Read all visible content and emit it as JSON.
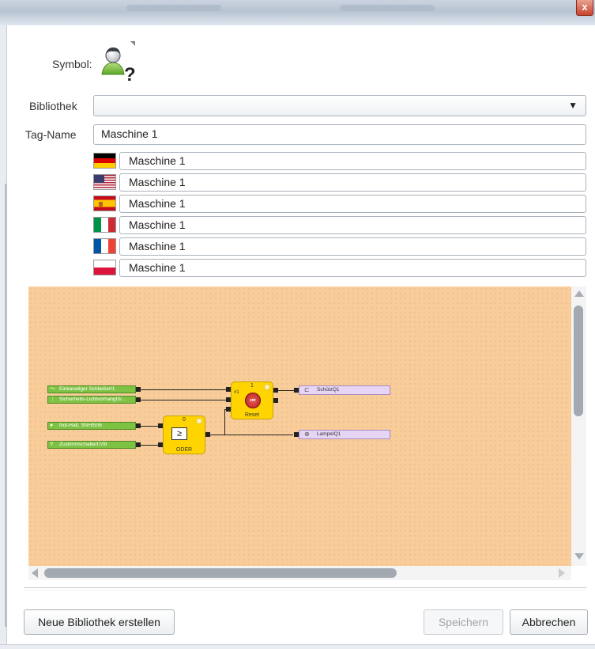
{
  "window": {
    "close_label": "x"
  },
  "form": {
    "symbol_label": "Symbol:",
    "symbol_icon": "user-question-icon",
    "library_label": "Bibliothek",
    "library_value": "",
    "dropdown_arrow": "▼",
    "tag_label": "Tag-Name",
    "tag_value": "Maschine 1",
    "translations": [
      {
        "flag": "de-flag-icon",
        "value": "Maschine 1"
      },
      {
        "flag": "us-flag-icon",
        "value": "Maschine 1"
      },
      {
        "flag": "es-flag-icon",
        "value": "Maschine 1"
      },
      {
        "flag": "it-flag-icon",
        "value": "Maschine 1"
      },
      {
        "flag": "fr-flag-icon",
        "value": "Maschine 1"
      },
      {
        "flag": "pl-flag-icon",
        "value": "Maschine 1"
      }
    ]
  },
  "diagram": {
    "colors": {
      "background": "#f8cd9a",
      "input": "#7ec243",
      "output": "#e6d5f4",
      "block": "#ffd400"
    },
    "inputs": [
      {
        "label": "Einkanaliger SchließerI1"
      },
      {
        "label": "Sicherheits-LichtvorhangI3/..."
      },
      {
        "label": "Not-Halt, SNHI5/I6"
      },
      {
        "label": "ZustimmschalterI7/I8"
      }
    ],
    "blocks": [
      {
        "name": "Reset",
        "number": "1",
        "port_label": "#1",
        "icon": "reset-icon"
      },
      {
        "name": "ODER",
        "number": "0",
        "symbol": "≥",
        "icon": "or-gate-icon"
      }
    ],
    "outputs": [
      {
        "label": "SchützQ1",
        "icon": "contactor-icon"
      },
      {
        "label": "LampeIQ1",
        "icon": "lamp-icon"
      }
    ]
  },
  "buttons": {
    "new_library": "Neue Bibliothek erstellen",
    "save": "Speichern",
    "cancel": "Abbrechen"
  }
}
